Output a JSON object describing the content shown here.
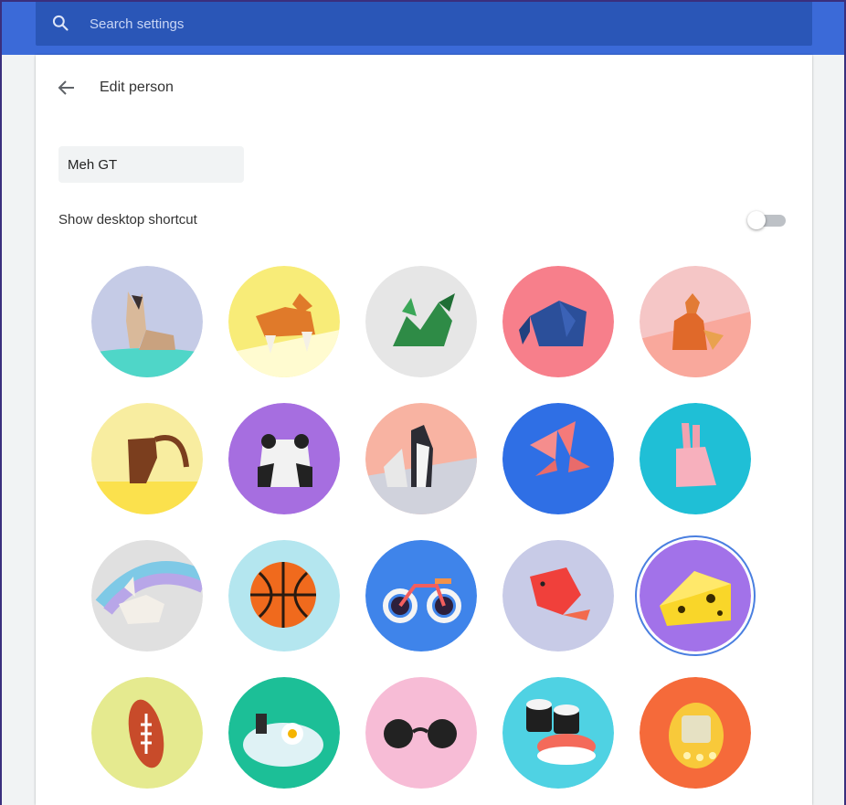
{
  "search": {
    "placeholder": "Search settings"
  },
  "page": {
    "title": "Edit person"
  },
  "name_field": {
    "value": "Meh GT"
  },
  "shortcut": {
    "label": "Show desktop shortcut",
    "enabled": false
  },
  "colors": {
    "header": "#3b6ad8",
    "search_bar": "#2a56b7",
    "selection_ring": "#4a7fe0"
  },
  "avatars": [
    {
      "name": "cat",
      "bg": "#c5cbe6",
      "selected": false
    },
    {
      "name": "corgi",
      "bg": "#f8ec78",
      "selected": false
    },
    {
      "name": "dragon",
      "bg": "#e6e6e6",
      "selected": false
    },
    {
      "name": "elephant",
      "bg": "#f77f8b",
      "selected": false
    },
    {
      "name": "fox",
      "bg": "#f5c6c6",
      "selected": false
    },
    {
      "name": "monkey",
      "bg": "#f8eda0",
      "selected": false
    },
    {
      "name": "panda",
      "bg": "#a66ee0",
      "selected": false
    },
    {
      "name": "penguin",
      "bg": "#f8b3a2",
      "selected": false
    },
    {
      "name": "butterfly",
      "bg": "#2f6fe5",
      "selected": false
    },
    {
      "name": "rabbit",
      "bg": "#1fbfd6",
      "selected": false
    },
    {
      "name": "unicorn",
      "bg": "#e0e0e0",
      "selected": false
    },
    {
      "name": "basketball",
      "bg": "#b4e6ef",
      "selected": false
    },
    {
      "name": "bicycle",
      "bg": "#3f84ea",
      "selected": false
    },
    {
      "name": "bird",
      "bg": "#c8cbe7",
      "selected": false
    },
    {
      "name": "cheese",
      "bg": "#a272e9",
      "selected": true
    },
    {
      "name": "football",
      "bg": "#e5ea8f",
      "selected": false
    },
    {
      "name": "ramen",
      "bg": "#1cbf97",
      "selected": false
    },
    {
      "name": "sunglasses",
      "bg": "#f7bcd6",
      "selected": false
    },
    {
      "name": "sushi",
      "bg": "#4fd2e3",
      "selected": false
    },
    {
      "name": "tamagotchi",
      "bg": "#f56a3a",
      "selected": false
    }
  ]
}
